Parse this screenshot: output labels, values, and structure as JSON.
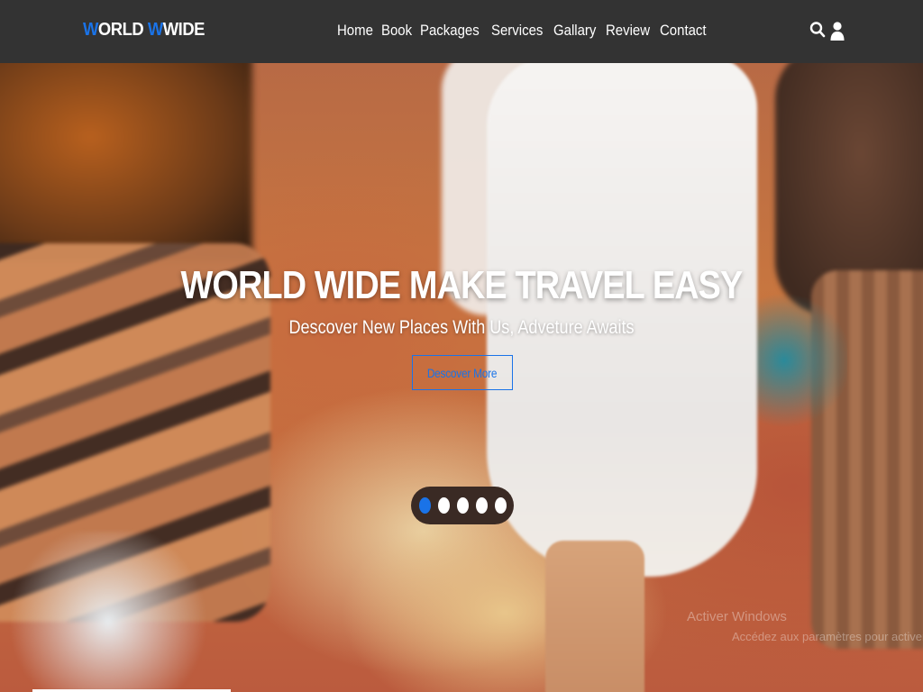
{
  "header": {
    "logo": {
      "part1_accent": "W",
      "part1_rest": "ORLD ",
      "part2_accent": "W",
      "part2_rest": "WIDE"
    },
    "nav": [
      {
        "label": "Home"
      },
      {
        "label": "Book"
      },
      {
        "label": "Packages"
      },
      {
        "label": "Services"
      },
      {
        "label": "Gallary"
      },
      {
        "label": "Review"
      },
      {
        "label": "Contact"
      }
    ],
    "icons": [
      "search-icon",
      "user-icon"
    ]
  },
  "hero": {
    "title": "WORLD WIDE MAKE TRAVEL EASY",
    "subtitle": "Descover New Places With Us, Adveture Awaits",
    "cta_label": "Descover More",
    "slides": 5,
    "active_slide": 1
  },
  "watermark": {
    "line1": "Activer Windows",
    "line2": "Accédez aux paramètres pour activer Windows."
  },
  "colors": {
    "header_bg": "#333333",
    "accent": "#1a73e8",
    "text": "#ffffff"
  }
}
